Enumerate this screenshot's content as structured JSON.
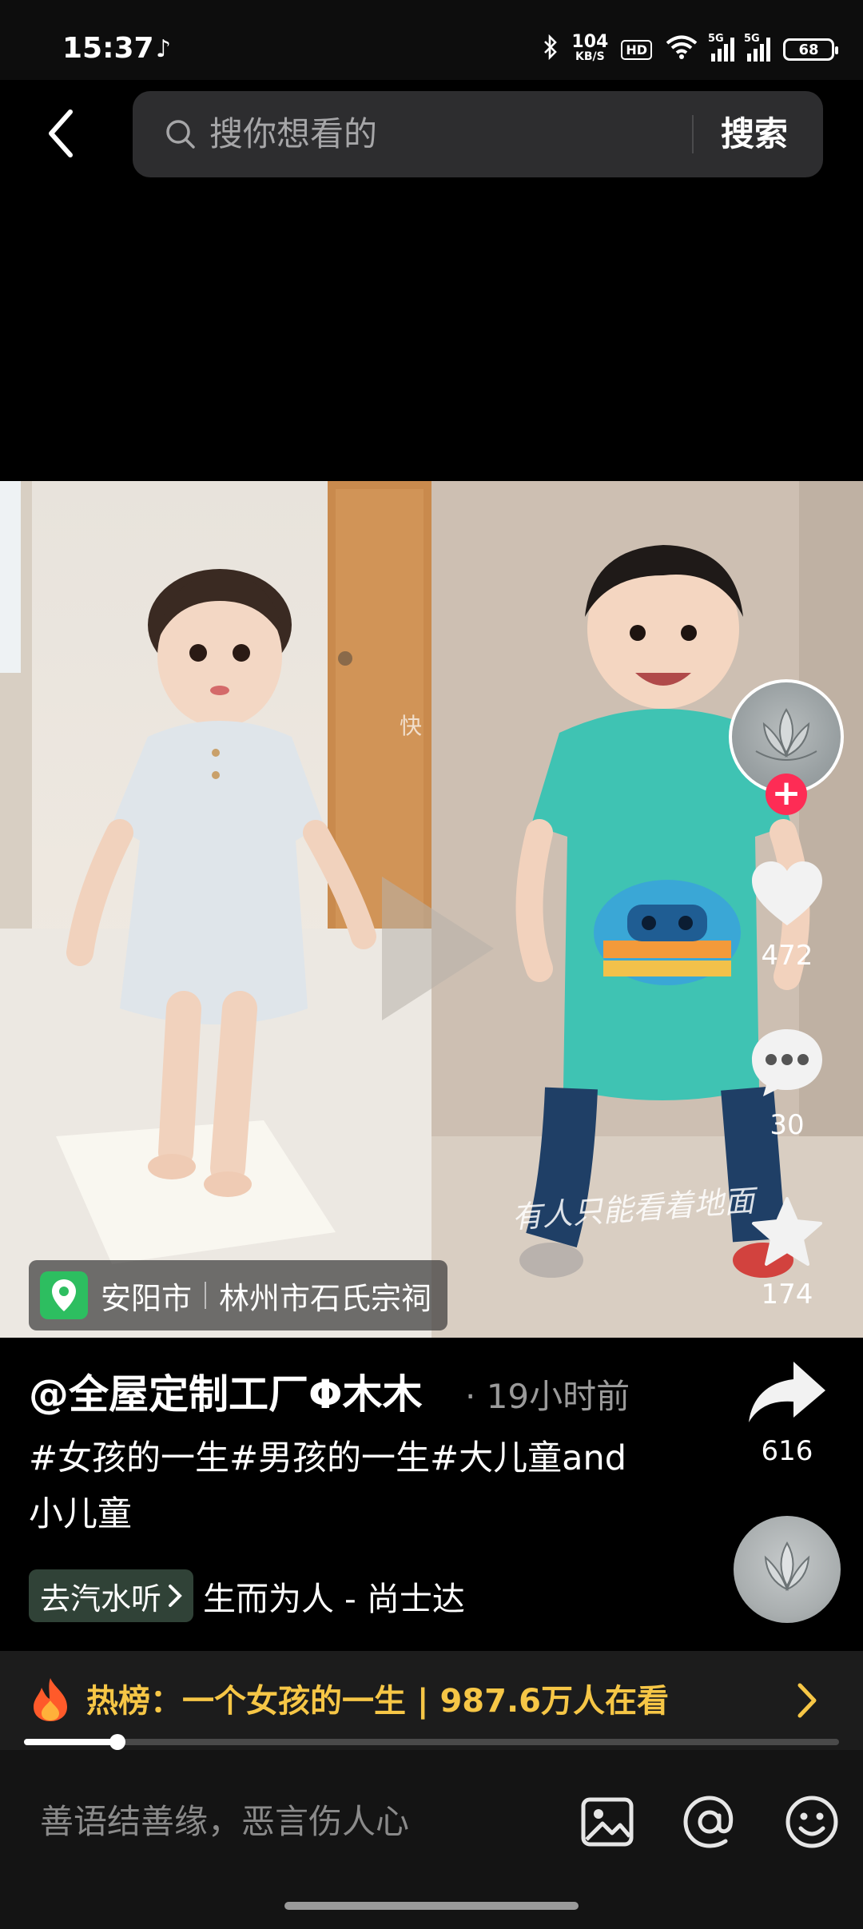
{
  "status_bar": {
    "time": "15:37",
    "app_icon": "tiktok-icon",
    "net_speed_value": "104",
    "net_speed_unit": "KB/S",
    "hd_label": "HD",
    "signal_label_1": "5G",
    "signal_label_2": "5G",
    "battery": "68"
  },
  "search": {
    "placeholder": "搜你想看的",
    "button_label": "搜索"
  },
  "video": {
    "caption": "有人只能看着地面",
    "watermark": "快",
    "location_city": "安阳市",
    "location_place": "林州市石氏宗祠"
  },
  "actions": {
    "likes": "472",
    "comments": "30",
    "favorites": "174",
    "shares": "616"
  },
  "post": {
    "author": "@全屋定制工厂Φ木木",
    "time": "· 19小时前",
    "description": "#女孩的一生#男孩的一生#大儿童and 小儿童",
    "music_chip_label": "去汽水听",
    "music_name": "生而为人 - 尚士达"
  },
  "hot_list": {
    "label": "热榜：一个女孩的一生 | 987.6万人在看"
  },
  "playback": {
    "progress": 0.115
  },
  "comment": {
    "placeholder": "善语结善缘，恶言伤人心"
  },
  "colors": {
    "accent_red": "#fe2c55",
    "hot_yellow": "#f6c646",
    "location_green": "#2dbe60"
  }
}
